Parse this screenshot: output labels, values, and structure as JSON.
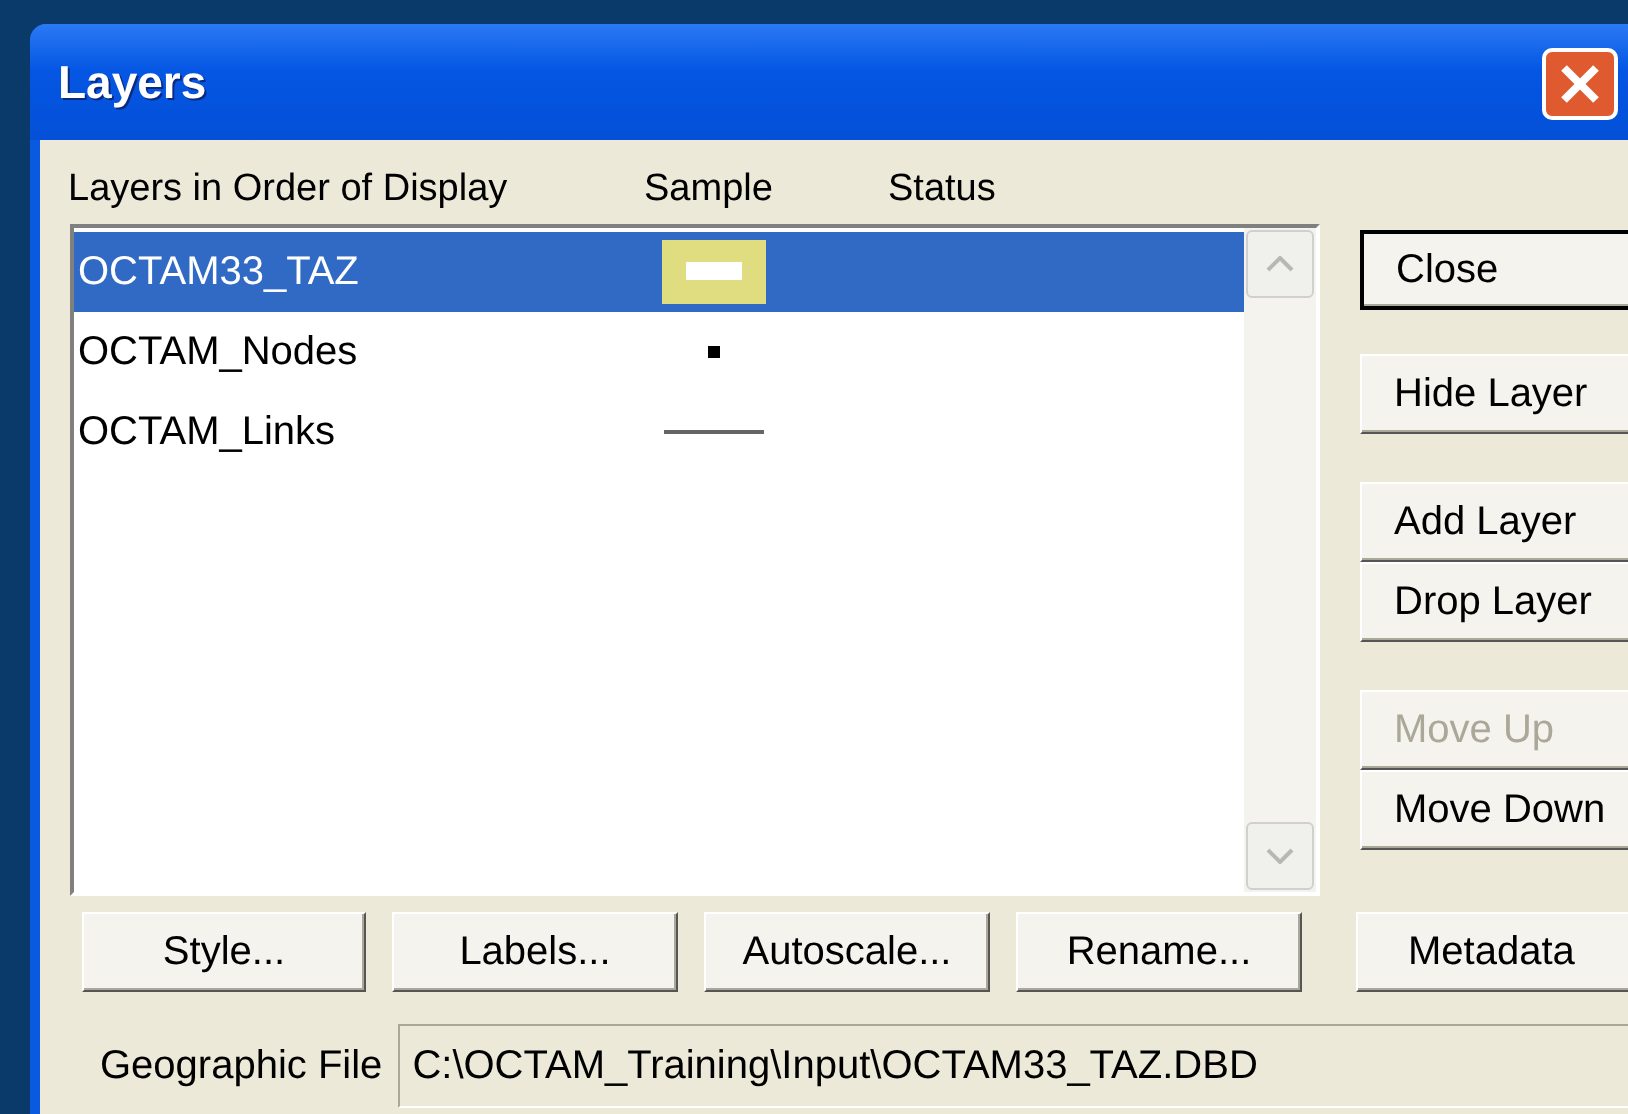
{
  "window": {
    "title": "Layers"
  },
  "columns": [
    "Layers in Order of Display",
    "Sample",
    "Status"
  ],
  "layers": [
    {
      "name": "OCTAM33_TAZ",
      "kind": "area",
      "selected": true
    },
    {
      "name": "OCTAM_Nodes",
      "kind": "point",
      "selected": false
    },
    {
      "name": "OCTAM_Links",
      "kind": "line",
      "selected": false
    }
  ],
  "side_buttons": [
    {
      "label": "Close",
      "disabled": false,
      "default": true
    },
    {
      "label": "Hide Layer",
      "disabled": false,
      "default": false
    },
    {
      "label": "Add Layer",
      "disabled": false,
      "default": false
    },
    {
      "label": "Drop Layer",
      "disabled": false,
      "default": false
    },
    {
      "label": "Move Up",
      "disabled": true,
      "default": false
    },
    {
      "label": "Move Down",
      "disabled": false,
      "default": false
    }
  ],
  "bottom_buttons": [
    "Style...",
    "Labels...",
    "Autoscale...",
    "Rename..."
  ],
  "metadata_button": "Metadata",
  "geographic_file": {
    "label": "Geographic File",
    "value": "C:\\OCTAM_Training\\Input\\OCTAM33_TAZ.DBD"
  }
}
